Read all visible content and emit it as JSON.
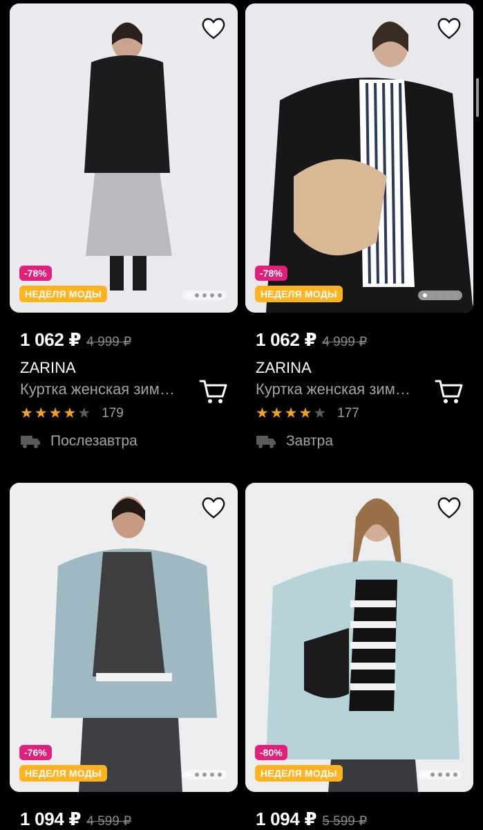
{
  "products": [
    {
      "discount": "-78%",
      "badge": "НЕДЕЛЯ МОДЫ",
      "price": "1 062 ₽",
      "old_price": "4 999 ₽",
      "brand": "ZARINA",
      "title": "Куртка женская зим…",
      "rating_stars": 4,
      "reviews": "179",
      "delivery": "Послезавтра",
      "jacket_color": "#1b1c1e",
      "lower_color": "#b9bbbf",
      "photo_index": 1,
      "photo_count": 5
    },
    {
      "discount": "-78%",
      "badge": "НЕДЕЛЯ МОДЫ",
      "price": "1 062 ₽",
      "old_price": "4 999 ₽",
      "brand": "ZARINA",
      "title": "Куртка женская зим…",
      "rating_stars": 4,
      "reviews": "177",
      "delivery": "Завтра",
      "jacket_color": "#161719",
      "lower_color": "#2a2b2e",
      "photo_index": 1,
      "photo_count": 5
    },
    {
      "discount": "-76%",
      "badge": "НЕДЕЛЯ МОДЫ",
      "price": "1 094 ₽",
      "old_price": "4 599 ₽",
      "jacket_color": "#9fb9c2",
      "lower_color": "#3d3f44",
      "photo_index": 1,
      "photo_count": 5
    },
    {
      "discount": "-80%",
      "badge": "НЕДЕЛЯ МОДЫ",
      "price": "1 094 ₽",
      "old_price": "5 599 ₽",
      "jacket_color": "#b5d3d8",
      "lower_color": "#3a3b3f",
      "photo_index": 1,
      "photo_count": 5
    }
  ],
  "colors": {
    "discount_bg": "#e0207a",
    "badge_bg": "#ffb31f",
    "star": "#f7a319",
    "muted": "#a3a3a3"
  }
}
